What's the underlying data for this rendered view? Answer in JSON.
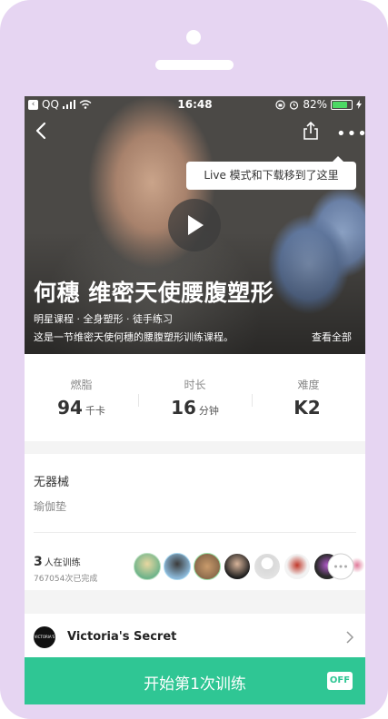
{
  "status_bar": {
    "back_app": "QQ",
    "time": "16:48",
    "battery": "82%",
    "battery_level": 0.82
  },
  "header": {
    "tooltip": "Live 模式和下载移到了这里",
    "icons": {
      "back": "chevron-left-icon",
      "share": "share-icon",
      "more": "more-dots-icon",
      "play": "play-icon"
    }
  },
  "course": {
    "title": "何穗 维密天使腰腹塑形",
    "tags": "明星课程 · 全身塑形 · 徒手练习",
    "description": "这是一节维密天使何穗的腰腹塑形训练课程。",
    "view_all": "查看全部"
  },
  "stats": [
    {
      "label": "燃脂",
      "value": "94",
      "unit": "千卡"
    },
    {
      "label": "时长",
      "value": "16",
      "unit": "分钟"
    },
    {
      "label": "难度",
      "value": "K2",
      "unit": ""
    }
  ],
  "equipment": {
    "title": "无器械",
    "item": "瑜伽垫"
  },
  "trainers": {
    "count": "3",
    "count_label": "人在训练",
    "completed": "767054次已完成"
  },
  "brand": {
    "logo_text": "VICTORIA'S SECRET",
    "name": "Victoria's Secret"
  },
  "start_button": {
    "label": "开始第1次训练",
    "off_badge": "OFF"
  },
  "colors": {
    "accent": "#2fc694",
    "frame": "#e6d5f2",
    "battery": "#4cd964"
  }
}
